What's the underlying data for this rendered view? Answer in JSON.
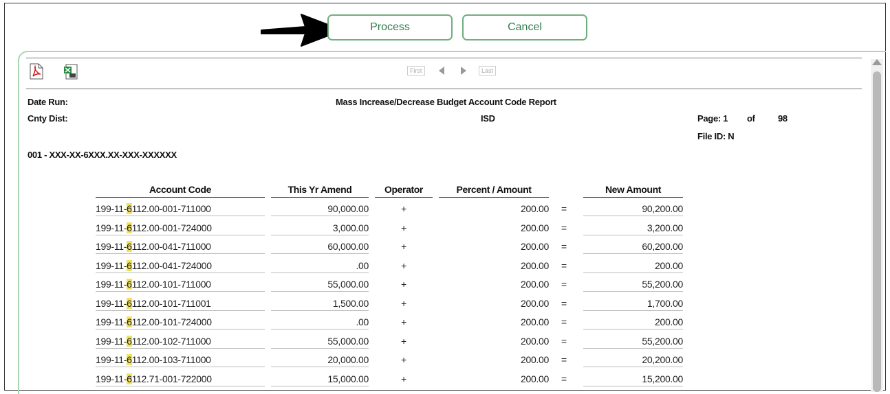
{
  "buttons": {
    "process": "Process",
    "cancel": "Cancel"
  },
  "toolbar": {
    "export_icons": [
      "pdf-icon",
      "excel-icon"
    ],
    "nav": {
      "first": "First",
      "last": "Last"
    }
  },
  "report": {
    "date_run_label": "Date Run:",
    "title": "Mass Increase/Decrease Budget Account Code Report",
    "cnty_dist_label": "Cnty Dist:",
    "district": "ISD",
    "page_label": "Page: 1",
    "of_label": "of",
    "total_pages": "98",
    "file_id": "File ID: N",
    "mask": "001 - XXX-XX-6XXX.XX-XXX-XXXXXX"
  },
  "table": {
    "headers": [
      "Account Code",
      "This Yr Amend",
      "Operator",
      "Percent / Amount",
      "New Amount"
    ],
    "highlight_color": "#f3e25a",
    "rows": [
      {
        "pre": "199-11-",
        "hl": "6",
        "post": "112.00-001-711000",
        "amend": "90,000.00",
        "op": "+",
        "pct": "200.00",
        "eq": "=",
        "new": "90,200.00"
      },
      {
        "pre": "199-11-",
        "hl": "6",
        "post": "112.00-001-724000",
        "amend": "3,000.00",
        "op": "+",
        "pct": "200.00",
        "eq": "=",
        "new": "3,200.00"
      },
      {
        "pre": "199-11-",
        "hl": "6",
        "post": "112.00-041-711000",
        "amend": "60,000.00",
        "op": "+",
        "pct": "200.00",
        "eq": "=",
        "new": "60,200.00"
      },
      {
        "pre": "199-11-",
        "hl": "6",
        "post": "112.00-041-724000",
        "amend": ".00",
        "op": "+",
        "pct": "200.00",
        "eq": "=",
        "new": "200.00"
      },
      {
        "pre": "199-11-",
        "hl": "6",
        "post": "112.00-101-711000",
        "amend": "55,000.00",
        "op": "+",
        "pct": "200.00",
        "eq": "=",
        "new": "55,200.00"
      },
      {
        "pre": "199-11-",
        "hl": "6",
        "post": "112.00-101-711001",
        "amend": "1,500.00",
        "op": "+",
        "pct": "200.00",
        "eq": "=",
        "new": "1,700.00"
      },
      {
        "pre": "199-11-",
        "hl": "6",
        "post": "112.00-101-724000",
        "amend": ".00",
        "op": "+",
        "pct": "200.00",
        "eq": "=",
        "new": "200.00"
      },
      {
        "pre": "199-11-",
        "hl": "6",
        "post": "112.00-102-711000",
        "amend": "55,000.00",
        "op": "+",
        "pct": "200.00",
        "eq": "=",
        "new": "55,200.00"
      },
      {
        "pre": "199-11-",
        "hl": "6",
        "post": "112.00-103-711000",
        "amend": "20,000.00",
        "op": "+",
        "pct": "200.00",
        "eq": "=",
        "new": "20,200.00"
      },
      {
        "pre": "199-11-",
        "hl": "6",
        "post": "112.71-001-722000",
        "amend": "15,000.00",
        "op": "+",
        "pct": "200.00",
        "eq": "=",
        "new": "15,200.00"
      }
    ]
  }
}
